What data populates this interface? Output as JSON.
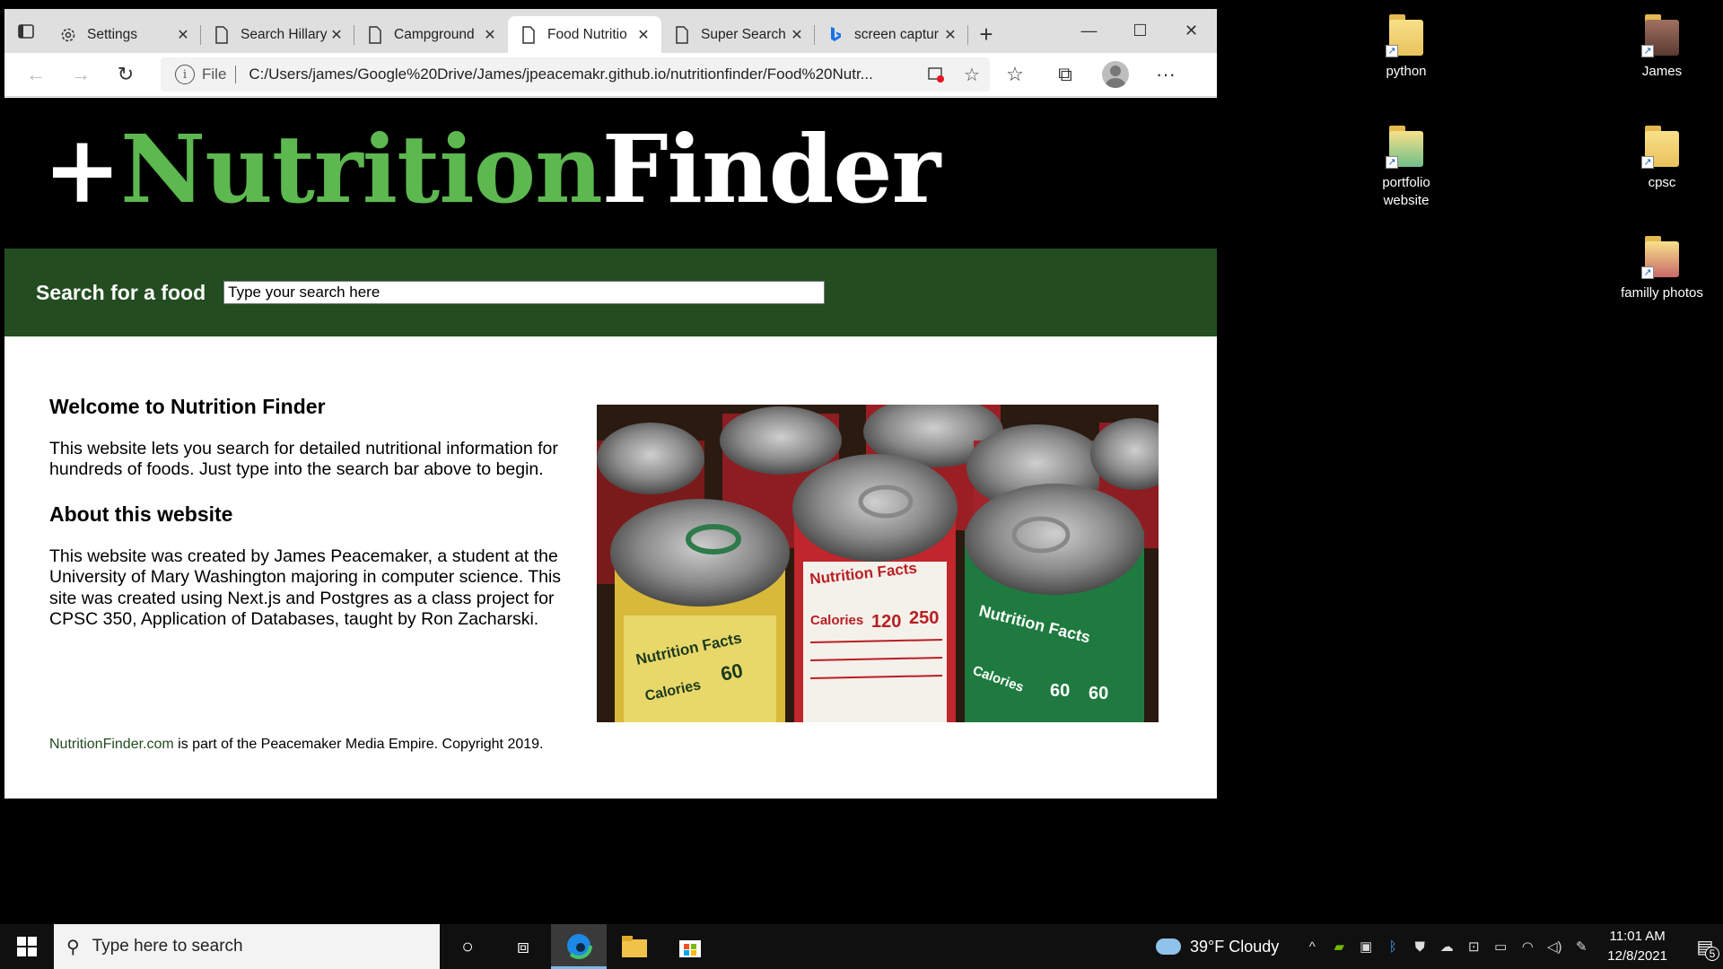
{
  "browser": {
    "tabs": [
      {
        "label": "Settings",
        "icon": "gear-icon",
        "active": false
      },
      {
        "label": "Search Hillary",
        "icon": "page-icon",
        "active": false
      },
      {
        "label": "Campground",
        "icon": "page-icon",
        "active": false
      },
      {
        "label": "Food Nutritio",
        "icon": "page-icon",
        "active": true
      },
      {
        "label": "Super Search",
        "icon": "page-icon",
        "active": false
      },
      {
        "label": "screen captur",
        "icon": "bing-icon",
        "active": false
      }
    ],
    "address": {
      "scheme": "File",
      "url": "C:/Users/james/Google%20Drive/James/jpeacemakr.github.io/nutritionfinder/Food%20Nutr..."
    }
  },
  "page": {
    "logo": {
      "plus": "+",
      "part1": "Nutrition",
      "part2": "Finder"
    },
    "search": {
      "label": "Search for a food",
      "value": "Type your search here"
    },
    "welcome_title": "Welcome to Nutrition Finder",
    "welcome_text": "This website lets you search for detailed nutritional information for hundreds of foods. Just type into the search bar above to begin.",
    "about_title": "About this website",
    "about_text": "This website was created by James Peacemaker, a student at the University of Mary Washington majoring in computer science. This site was created using Next.js and Postgres as a class project for CPSC 350, Application of Databases, taught by Ron Zacharski.",
    "footer_link": "NutritionFinder.com",
    "footer_text": " is part of the Peacemaker Media Empire. Copyright 2019.",
    "photo_labels": {
      "can_left": "Nutrition Facts",
      "can_left_cal": "Calories",
      "can_left_num": "60",
      "can_center": "Nutrition Facts",
      "can_center_cal": "Calories",
      "can_center_num1": "120",
      "can_center_num2": "250",
      "can_right": "Nutrition Facts",
      "can_right_cal": "Calories",
      "can_right_num1": "60",
      "can_right_num2": "60"
    }
  },
  "desktop": {
    "icons": [
      {
        "label": "python"
      },
      {
        "label": "James"
      },
      {
        "label": "portfolio website"
      },
      {
        "label": "cpsc"
      },
      {
        "label": "familly photos"
      }
    ]
  },
  "taskbar": {
    "search_placeholder": "Type here to search",
    "weather": "39°F  Cloudy",
    "time": "11:01 AM",
    "date": "12/8/2021",
    "notification_count": "5"
  },
  "colors": {
    "brand_green": "#5cb84f",
    "band_green": "#234d20"
  }
}
